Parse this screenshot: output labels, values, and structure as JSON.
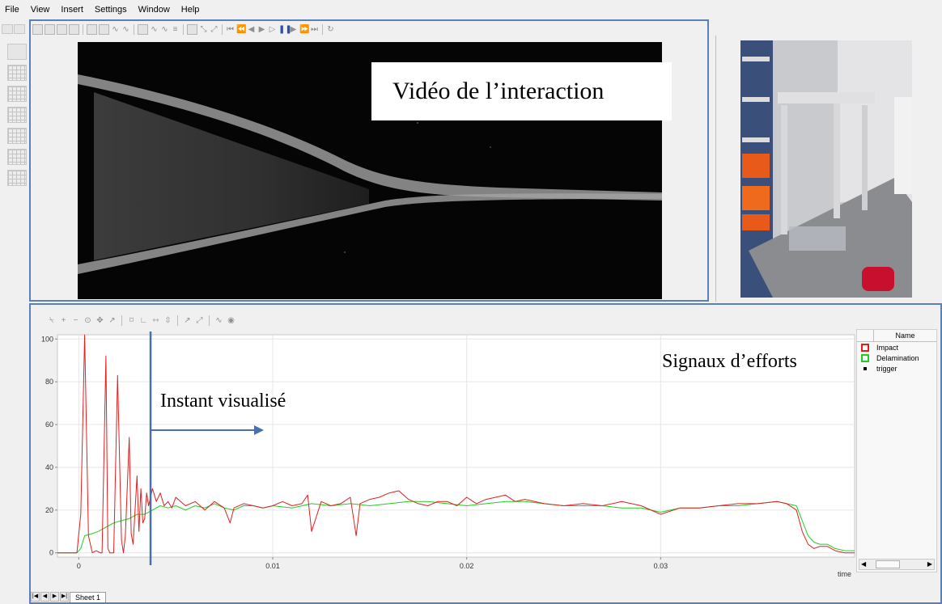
{
  "menu": [
    "File",
    "View",
    "Insert",
    "Settings",
    "Window",
    "Help"
  ],
  "video": {
    "overlay_label": "Vidéo de l’interaction"
  },
  "plot": {
    "overlay_signal_label": "Signaux d’efforts",
    "overlay_instant_label": "Instant visualisé",
    "sheet_tab": "Sheet 1",
    "legend": {
      "header": "Name",
      "items": [
        {
          "name": "Impact",
          "color": "#e02020",
          "marker": "square"
        },
        {
          "name": "Delamination",
          "color": "#22cc22",
          "marker": "square"
        },
        {
          "name": "trigger",
          "color": "#000000",
          "marker": "dot"
        }
      ]
    }
  },
  "chart_data": {
    "type": "line",
    "xlabel": "time",
    "ylabel": "",
    "xlim": [
      -0.0011,
      0.04
    ],
    "ylim": [
      -2,
      102
    ],
    "xticks": [
      0,
      0.01,
      0.02,
      0.03
    ],
    "xtick_labels": [
      "0",
      "0.01",
      "0.02",
      "0.03"
    ],
    "yticks": [
      0,
      20,
      40,
      60,
      80,
      100
    ],
    "grid": true,
    "legend_position": "right",
    "cursor_x": 0.0037,
    "series": [
      {
        "name": "Impact",
        "color": "#e02020",
        "x": [
          -0.0011,
          -0.0001,
          0.0001,
          0.0003,
          0.0005,
          0.0007,
          0.0009,
          0.0011,
          0.0012,
          0.0014,
          0.0015,
          0.0016,
          0.0018,
          0.002,
          0.0022,
          0.0023,
          0.0024,
          0.0026,
          0.0027,
          0.0028,
          0.003,
          0.0031,
          0.0032,
          0.0033,
          0.0034,
          0.0035,
          0.0036,
          0.0038,
          0.004,
          0.0042,
          0.0044,
          0.0046,
          0.0048,
          0.005,
          0.0055,
          0.006,
          0.0065,
          0.007,
          0.0075,
          0.0078,
          0.008,
          0.0085,
          0.009,
          0.0095,
          0.01,
          0.0105,
          0.011,
          0.0115,
          0.0118,
          0.012,
          0.0125,
          0.013,
          0.0135,
          0.014,
          0.0143,
          0.0145,
          0.015,
          0.0155,
          0.016,
          0.0165,
          0.017,
          0.0175,
          0.018,
          0.0185,
          0.019,
          0.0195,
          0.02,
          0.0205,
          0.021,
          0.0215,
          0.022,
          0.0225,
          0.023,
          0.0235,
          0.024,
          0.025,
          0.026,
          0.027,
          0.028,
          0.029,
          0.03,
          0.031,
          0.032,
          0.033,
          0.034,
          0.035,
          0.036,
          0.0365,
          0.037,
          0.0373,
          0.0376,
          0.0379,
          0.0382,
          0.0386,
          0.039,
          0.0395,
          0.04
        ],
        "values": [
          0,
          0,
          18,
          102,
          8,
          0,
          1,
          0,
          0,
          92,
          2,
          0,
          0,
          83,
          6,
          0,
          8,
          54,
          9,
          4,
          36,
          10,
          30,
          14,
          16,
          28,
          22,
          30,
          24,
          28,
          22,
          24,
          21,
          26,
          22,
          24,
          20,
          24,
          21,
          14,
          21,
          23,
          22,
          21,
          22,
          24,
          22,
          23,
          27,
          10,
          24,
          22,
          23,
          26,
          8,
          23,
          25,
          26,
          28,
          29,
          25,
          23,
          22,
          24,
          24,
          22,
          26,
          23,
          25,
          26,
          27,
          24,
          25,
          24,
          23,
          22,
          23,
          22,
          24,
          22,
          18,
          21,
          21,
          22,
          23,
          23,
          24,
          23,
          20,
          10,
          4,
          2,
          3,
          3,
          1,
          0,
          0
        ],
        "_note": "read off plot"
      },
      {
        "name": "Delamination",
        "color": "#22cc22",
        "x": [
          -0.0011,
          -0.0001,
          0.0001,
          0.0003,
          0.0007,
          0.001,
          0.0014,
          0.0018,
          0.0022,
          0.0026,
          0.003,
          0.0034,
          0.0038,
          0.0042,
          0.0046,
          0.005,
          0.0055,
          0.006,
          0.0065,
          0.007,
          0.0075,
          0.008,
          0.0085,
          0.009,
          0.0095,
          0.01,
          0.011,
          0.012,
          0.013,
          0.014,
          0.015,
          0.016,
          0.017,
          0.018,
          0.019,
          0.02,
          0.021,
          0.022,
          0.023,
          0.024,
          0.025,
          0.026,
          0.027,
          0.028,
          0.029,
          0.03,
          0.031,
          0.032,
          0.033,
          0.034,
          0.035,
          0.036,
          0.0365,
          0.037,
          0.0373,
          0.0376,
          0.0379,
          0.0382,
          0.0386,
          0.039,
          0.0395,
          0.04
        ],
        "values": [
          0,
          0,
          2,
          8,
          9,
          10,
          12,
          14,
          15,
          16,
          18,
          18,
          20,
          22,
          21,
          22,
          20,
          22,
          21,
          23,
          21,
          20,
          22,
          22,
          21,
          22,
          21,
          23,
          22,
          23,
          22,
          23,
          24,
          24,
          23,
          22,
          23,
          24,
          24,
          23,
          22,
          22,
          22,
          21,
          21,
          19,
          21,
          21,
          22,
          22,
          23,
          24,
          23,
          22,
          15,
          8,
          5,
          4,
          4,
          2,
          1,
          1
        ]
      }
    ]
  }
}
